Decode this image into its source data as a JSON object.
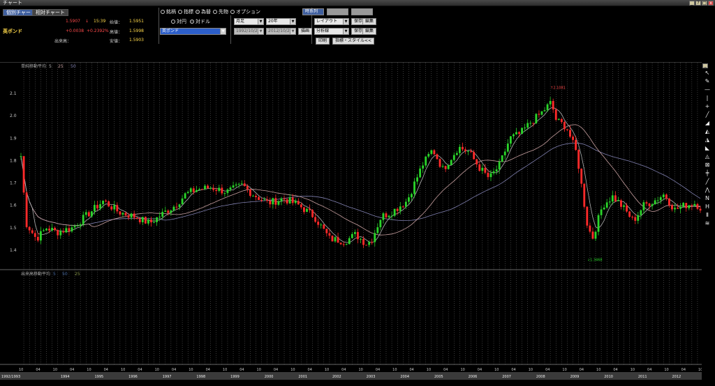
{
  "window": {
    "title": "チャート",
    "btn_min": "_",
    "btn_help": "?",
    "btn_max": "□",
    "btn_close": "x"
  },
  "tabs": {
    "single": "個別チャート",
    "relative": "相対チャート"
  },
  "quote": {
    "price": "1.5907",
    "price_sep": "↓",
    "time": "15:39",
    "open_label": "始値：",
    "open": "1.5951",
    "name": "英ポンド",
    "change": "+0.0038",
    "change_pct": "+0.2392%",
    "high_label": "高値：",
    "high": "1.5998",
    "volume_label": "出来高：",
    "low_label": "安値：",
    "low": "1.5903"
  },
  "category_radios": [
    {
      "label": "銘柄",
      "on": false
    },
    {
      "label": "指標",
      "on": false
    },
    {
      "label": "為替",
      "on": true
    },
    {
      "label": "先物",
      "on": false
    },
    {
      "label": "オプション",
      "on": false
    }
  ],
  "currency_radios": [
    {
      "label": "対円",
      "on": false
    },
    {
      "label": "対ドル",
      "on": true
    }
  ],
  "currency_select": "英ポンド",
  "period": {
    "unit": "月足",
    "range": "20年",
    "from": "1992/10/24",
    "to": "2012/10/24",
    "draw": "描画"
  },
  "toolbar": {
    "timeseries": "時系列",
    "btn2": "",
    "btn3": "",
    "layout": "レイアウト",
    "save": "保存",
    "edit": "編集",
    "analysis": "分析線",
    "save2": "保存",
    "edit2": "編集",
    "print": "印刷",
    "style": "指標・スタイル<<"
  },
  "chart_data": {
    "type": "candlestick",
    "main_legend": {
      "title": "単純移動平均",
      "items": [
        "5",
        "25",
        "50"
      ],
      "colors": [
        "#b0b0b0",
        "#c8a0a0",
        "#8080b0"
      ]
    },
    "volume_legend": {
      "title": "出来高移動平均",
      "items": [
        "5",
        "50",
        "25"
      ],
      "colors": [
        "#4a6ea8",
        "#4a6ea8",
        "#8a9a4a"
      ]
    },
    "y_ticks": [
      "2.1",
      "2.0",
      "1.9",
      "1.8",
      "1.7",
      "1.6",
      "1.5",
      "1.4"
    ],
    "ylim": [
      1.35,
      2.15
    ],
    "years": [
      "1992/1993",
      "1994",
      "1995",
      "1996",
      "1997",
      "1998",
      "1999",
      "2000",
      "2001",
      "2002",
      "2003",
      "2004",
      "2005",
      "2006",
      "2007",
      "2008",
      "2009",
      "2010",
      "2011",
      "2012"
    ],
    "month_ticks": [
      "10",
      "04"
    ],
    "annotations": {
      "high": "2.1081",
      "low": "1.3468"
    },
    "up_color": "#2ad52a",
    "down_color": "#ff2a2a",
    "anchors": [
      [
        0,
        1.82
      ],
      [
        2,
        1.52
      ],
      [
        6,
        1.45
      ],
      [
        10,
        1.5
      ],
      [
        14,
        1.48
      ],
      [
        20,
        1.5
      ],
      [
        26,
        1.56
      ],
      [
        32,
        1.62
      ],
      [
        38,
        1.57
      ],
      [
        44,
        1.55
      ],
      [
        50,
        1.52
      ],
      [
        56,
        1.57
      ],
      [
        60,
        1.6
      ],
      [
        64,
        1.65
      ],
      [
        68,
        1.67
      ],
      [
        74,
        1.68
      ],
      [
        80,
        1.66
      ],
      [
        86,
        1.69
      ],
      [
        90,
        1.65
      ],
      [
        96,
        1.61
      ],
      [
        102,
        1.63
      ],
      [
        108,
        1.6
      ],
      [
        114,
        1.55
      ],
      [
        120,
        1.45
      ],
      [
        126,
        1.44
      ],
      [
        130,
        1.47
      ],
      [
        134,
        1.43
      ],
      [
        136,
        1.44
      ],
      [
        140,
        1.55
      ],
      [
        144,
        1.57
      ],
      [
        150,
        1.62
      ],
      [
        156,
        1.78
      ],
      [
        160,
        1.85
      ],
      [
        164,
        1.76
      ],
      [
        170,
        1.86
      ],
      [
        174,
        1.84
      ],
      [
        178,
        1.77
      ],
      [
        182,
        1.72
      ],
      [
        186,
        1.78
      ],
      [
        190,
        1.9
      ],
      [
        194,
        1.92
      ],
      [
        198,
        1.97
      ],
      [
        202,
        2.01
      ],
      [
        206,
        2.06
      ],
      [
        208,
        1.98
      ],
      [
        212,
        1.95
      ],
      [
        216,
        1.83
      ],
      [
        220,
        1.52
      ],
      [
        222,
        1.45
      ],
      [
        226,
        1.6
      ],
      [
        230,
        1.64
      ],
      [
        234,
        1.59
      ],
      [
        238,
        1.53
      ],
      [
        242,
        1.6
      ],
      [
        246,
        1.62
      ],
      [
        250,
        1.65
      ],
      [
        254,
        1.58
      ],
      [
        258,
        1.6
      ],
      [
        262,
        1.61
      ],
      [
        264,
        1.59
      ]
    ]
  }
}
